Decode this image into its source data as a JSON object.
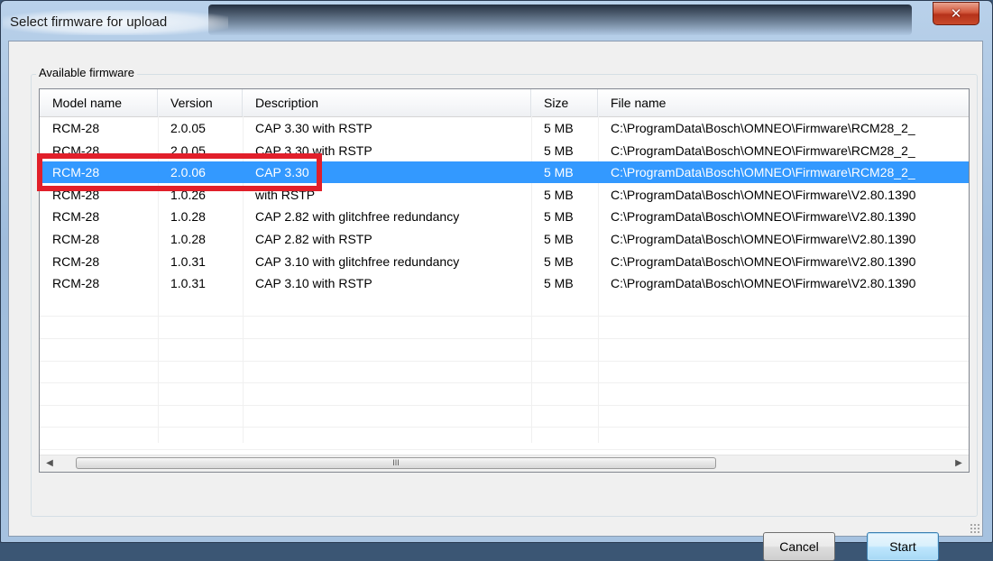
{
  "window": {
    "title": "Select firmware for upload",
    "close_glyph": "✕"
  },
  "group": {
    "label": "Available firmware"
  },
  "table": {
    "columns": [
      "Model name",
      "Version",
      "Description",
      "Size",
      "File name"
    ],
    "rows": [
      [
        "RCM-28",
        "2.0.05",
        "CAP 3.30 with RSTP",
        "5 MB",
        "C:\\ProgramData\\Bosch\\OMNEO\\Firmware\\RCM28_2_"
      ],
      [
        "RCM-28",
        "2.0.05",
        "CAP 3.30 with RSTP",
        "5 MB",
        "C:\\ProgramData\\Bosch\\OMNEO\\Firmware\\RCM28_2_"
      ],
      [
        "RCM-28",
        "2.0.06",
        "CAP 3.30",
        "5 MB",
        "C:\\ProgramData\\Bosch\\OMNEO\\Firmware\\RCM28_2_"
      ],
      [
        "RCM-28",
        "1.0.26",
        "with RSTP",
        "5 MB",
        "C:\\ProgramData\\Bosch\\OMNEO\\Firmware\\V2.80.1390"
      ],
      [
        "RCM-28",
        "1.0.28",
        "CAP 2.82 with glitchfree redundancy",
        "5 MB",
        "C:\\ProgramData\\Bosch\\OMNEO\\Firmware\\V2.80.1390"
      ],
      [
        "RCM-28",
        "1.0.28",
        "CAP 2.82 with RSTP",
        "5 MB",
        "C:\\ProgramData\\Bosch\\OMNEO\\Firmware\\V2.80.1390"
      ],
      [
        "RCM-28",
        "1.0.31",
        "CAP 3.10 with glitchfree redundancy",
        "5 MB",
        "C:\\ProgramData\\Bosch\\OMNEO\\Firmware\\V2.80.1390"
      ],
      [
        "RCM-28",
        "1.0.31",
        "CAP 3.10 with RSTP",
        "5 MB",
        "C:\\ProgramData\\Bosch\\OMNEO\\Firmware\\V2.80.1390"
      ]
    ],
    "selected_row_index": 2
  },
  "scrollbar": {
    "left_arrow": "◀",
    "right_arrow": "▶",
    "thumb_grip": "III"
  },
  "buttons": {
    "cancel": "Cancel",
    "start": "Start"
  },
  "colors": {
    "selection": "#3399ff",
    "highlight_box": "#e11f2a"
  }
}
